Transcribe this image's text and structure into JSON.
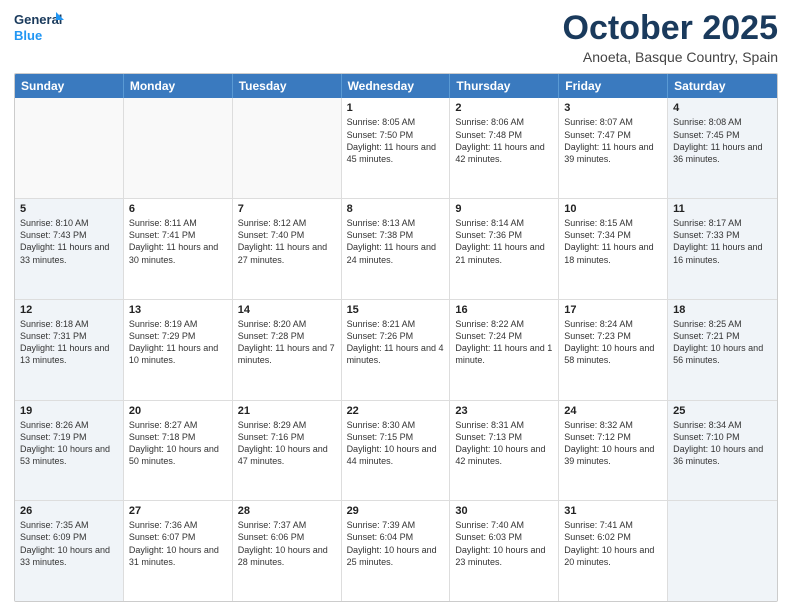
{
  "header": {
    "logo_line1": "General",
    "logo_line2": "Blue",
    "month_title": "October 2025",
    "location": "Anoeta, Basque Country, Spain"
  },
  "days_of_week": [
    "Sunday",
    "Monday",
    "Tuesday",
    "Wednesday",
    "Thursday",
    "Friday",
    "Saturday"
  ],
  "rows": [
    [
      {
        "day": "",
        "text": "",
        "empty": true
      },
      {
        "day": "",
        "text": "",
        "empty": true
      },
      {
        "day": "",
        "text": "",
        "empty": true
      },
      {
        "day": "1",
        "text": "Sunrise: 8:05 AM\nSunset: 7:50 PM\nDaylight: 11 hours\nand 45 minutes.",
        "empty": false
      },
      {
        "day": "2",
        "text": "Sunrise: 8:06 AM\nSunset: 7:48 PM\nDaylight: 11 hours\nand 42 minutes.",
        "empty": false
      },
      {
        "day": "3",
        "text": "Sunrise: 8:07 AM\nSunset: 7:47 PM\nDaylight: 11 hours\nand 39 minutes.",
        "empty": false
      },
      {
        "day": "4",
        "text": "Sunrise: 8:08 AM\nSunset: 7:45 PM\nDaylight: 11 hours\nand 36 minutes.",
        "empty": false,
        "shaded": true
      }
    ],
    [
      {
        "day": "5",
        "text": "Sunrise: 8:10 AM\nSunset: 7:43 PM\nDaylight: 11 hours\nand 33 minutes.",
        "empty": false,
        "shaded": true
      },
      {
        "day": "6",
        "text": "Sunrise: 8:11 AM\nSunset: 7:41 PM\nDaylight: 11 hours\nand 30 minutes.",
        "empty": false
      },
      {
        "day": "7",
        "text": "Sunrise: 8:12 AM\nSunset: 7:40 PM\nDaylight: 11 hours\nand 27 minutes.",
        "empty": false
      },
      {
        "day": "8",
        "text": "Sunrise: 8:13 AM\nSunset: 7:38 PM\nDaylight: 11 hours\nand 24 minutes.",
        "empty": false
      },
      {
        "day": "9",
        "text": "Sunrise: 8:14 AM\nSunset: 7:36 PM\nDaylight: 11 hours\nand 21 minutes.",
        "empty": false
      },
      {
        "day": "10",
        "text": "Sunrise: 8:15 AM\nSunset: 7:34 PM\nDaylight: 11 hours\nand 18 minutes.",
        "empty": false
      },
      {
        "day": "11",
        "text": "Sunrise: 8:17 AM\nSunset: 7:33 PM\nDaylight: 11 hours\nand 16 minutes.",
        "empty": false,
        "shaded": true
      }
    ],
    [
      {
        "day": "12",
        "text": "Sunrise: 8:18 AM\nSunset: 7:31 PM\nDaylight: 11 hours\nand 13 minutes.",
        "empty": false,
        "shaded": true
      },
      {
        "day": "13",
        "text": "Sunrise: 8:19 AM\nSunset: 7:29 PM\nDaylight: 11 hours\nand 10 minutes.",
        "empty": false
      },
      {
        "day": "14",
        "text": "Sunrise: 8:20 AM\nSunset: 7:28 PM\nDaylight: 11 hours\nand 7 minutes.",
        "empty": false
      },
      {
        "day": "15",
        "text": "Sunrise: 8:21 AM\nSunset: 7:26 PM\nDaylight: 11 hours\nand 4 minutes.",
        "empty": false
      },
      {
        "day": "16",
        "text": "Sunrise: 8:22 AM\nSunset: 7:24 PM\nDaylight: 11 hours\nand 1 minute.",
        "empty": false
      },
      {
        "day": "17",
        "text": "Sunrise: 8:24 AM\nSunset: 7:23 PM\nDaylight: 10 hours\nand 58 minutes.",
        "empty": false
      },
      {
        "day": "18",
        "text": "Sunrise: 8:25 AM\nSunset: 7:21 PM\nDaylight: 10 hours\nand 56 minutes.",
        "empty": false,
        "shaded": true
      }
    ],
    [
      {
        "day": "19",
        "text": "Sunrise: 8:26 AM\nSunset: 7:19 PM\nDaylight: 10 hours\nand 53 minutes.",
        "empty": false,
        "shaded": true
      },
      {
        "day": "20",
        "text": "Sunrise: 8:27 AM\nSunset: 7:18 PM\nDaylight: 10 hours\nand 50 minutes.",
        "empty": false
      },
      {
        "day": "21",
        "text": "Sunrise: 8:29 AM\nSunset: 7:16 PM\nDaylight: 10 hours\nand 47 minutes.",
        "empty": false
      },
      {
        "day": "22",
        "text": "Sunrise: 8:30 AM\nSunset: 7:15 PM\nDaylight: 10 hours\nand 44 minutes.",
        "empty": false
      },
      {
        "day": "23",
        "text": "Sunrise: 8:31 AM\nSunset: 7:13 PM\nDaylight: 10 hours\nand 42 minutes.",
        "empty": false
      },
      {
        "day": "24",
        "text": "Sunrise: 8:32 AM\nSunset: 7:12 PM\nDaylight: 10 hours\nand 39 minutes.",
        "empty": false
      },
      {
        "day": "25",
        "text": "Sunrise: 8:34 AM\nSunset: 7:10 PM\nDaylight: 10 hours\nand 36 minutes.",
        "empty": false,
        "shaded": true
      }
    ],
    [
      {
        "day": "26",
        "text": "Sunrise: 7:35 AM\nSunset: 6:09 PM\nDaylight: 10 hours\nand 33 minutes.",
        "empty": false,
        "shaded": true
      },
      {
        "day": "27",
        "text": "Sunrise: 7:36 AM\nSunset: 6:07 PM\nDaylight: 10 hours\nand 31 minutes.",
        "empty": false
      },
      {
        "day": "28",
        "text": "Sunrise: 7:37 AM\nSunset: 6:06 PM\nDaylight: 10 hours\nand 28 minutes.",
        "empty": false
      },
      {
        "day": "29",
        "text": "Sunrise: 7:39 AM\nSunset: 6:04 PM\nDaylight: 10 hours\nand 25 minutes.",
        "empty": false
      },
      {
        "day": "30",
        "text": "Sunrise: 7:40 AM\nSunset: 6:03 PM\nDaylight: 10 hours\nand 23 minutes.",
        "empty": false
      },
      {
        "day": "31",
        "text": "Sunrise: 7:41 AM\nSunset: 6:02 PM\nDaylight: 10 hours\nand 20 minutes.",
        "empty": false
      },
      {
        "day": "",
        "text": "",
        "empty": true,
        "shaded": true
      }
    ]
  ]
}
